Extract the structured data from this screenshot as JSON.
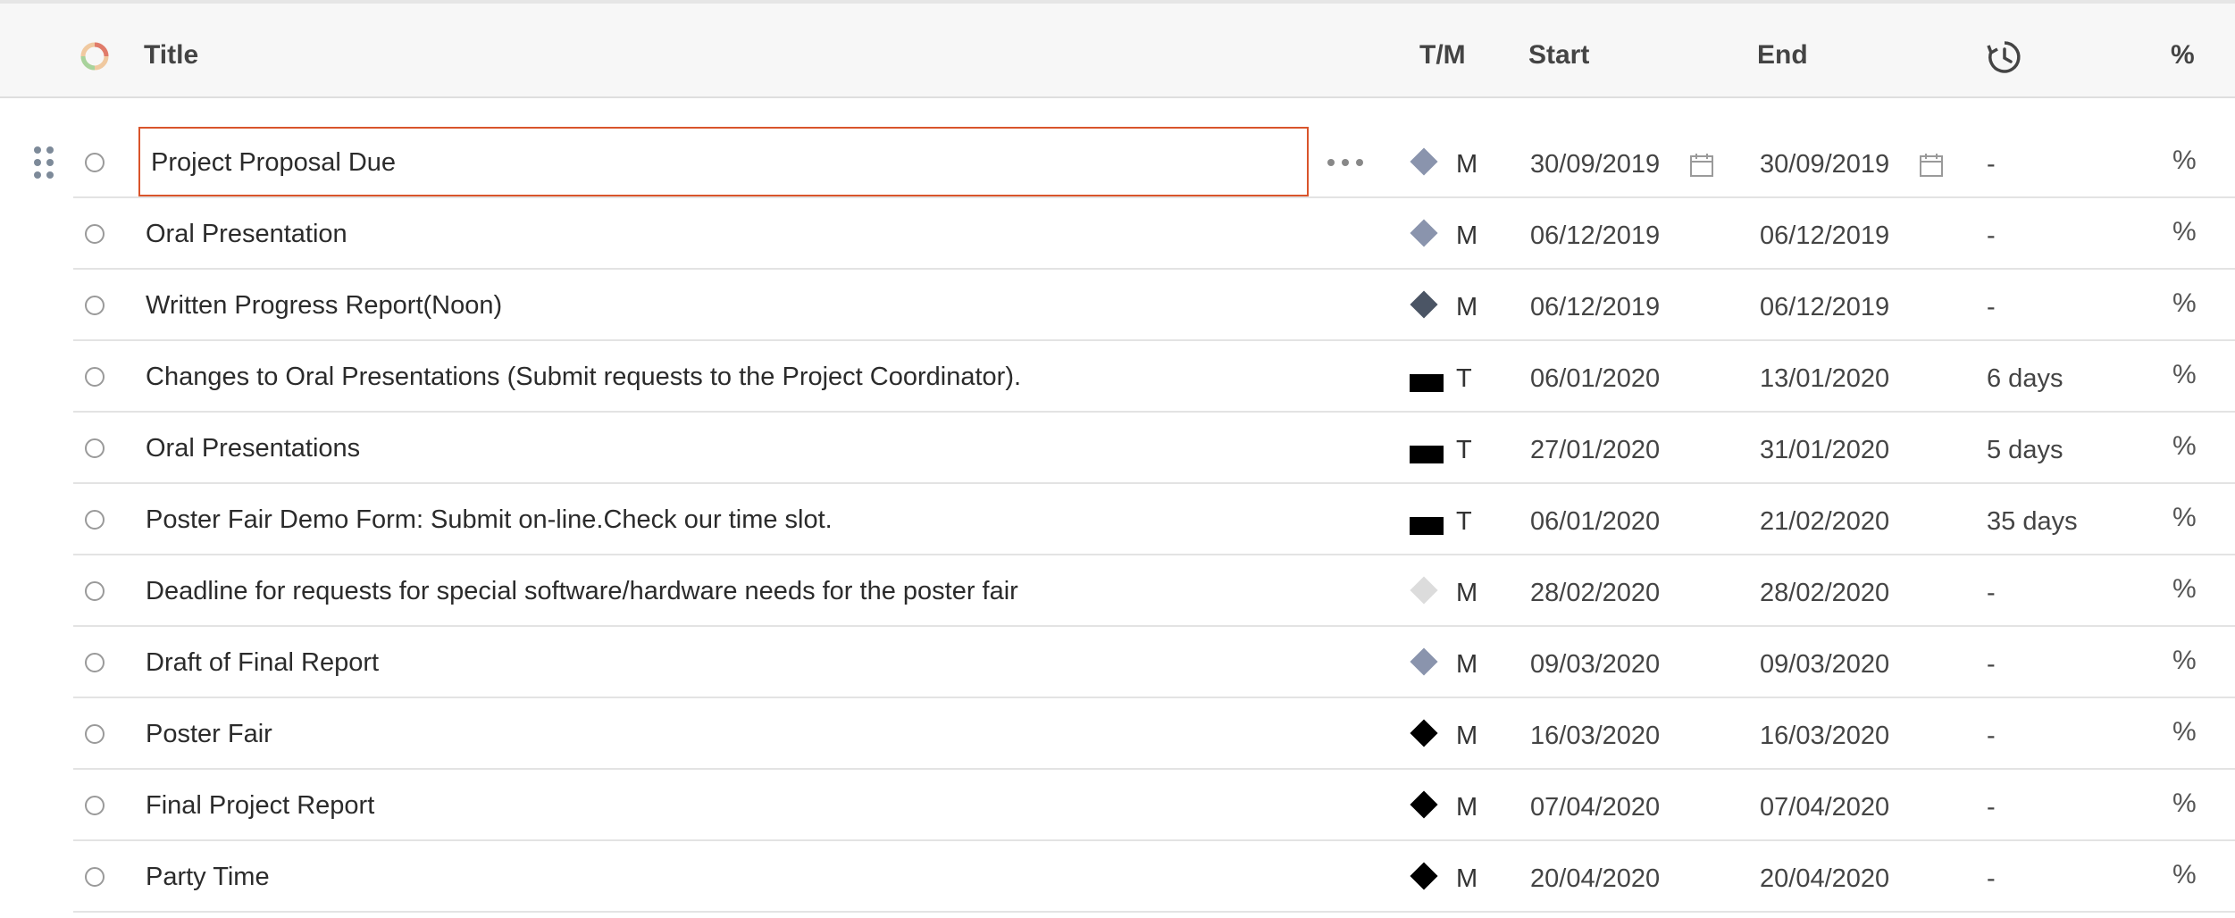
{
  "header": {
    "title": "Title",
    "type_column": "T/M",
    "start": "Start",
    "end": "End",
    "percent": "%",
    "history_icon": "history-clock-icon",
    "progress_icon": "progress-ring-icon"
  },
  "colors": {
    "accent_border": "#d9542b",
    "milestone_blue": "#8a94ad",
    "milestone_dark": "#4b5565",
    "milestone_light": "#dcdcdc",
    "milestone_black": "#000000",
    "task_bar": "#000000"
  },
  "more_icon": "more-dots-icon",
  "drag_icon": "drag-handle-icon",
  "calendar_icon": "calendar-icon",
  "rows": [
    {
      "title": "Project Proposal Due",
      "type": "M",
      "start": "30/09/2019",
      "end": "30/09/2019",
      "duration": "-",
      "percent": "%",
      "marker": "milestone_blue"
    },
    {
      "title": "Oral Presentation",
      "type": "M",
      "start": "06/12/2019",
      "end": "06/12/2019",
      "duration": "-",
      "percent": "%",
      "marker": "milestone_blue"
    },
    {
      "title": "Written Progress Report(Noon)",
      "type": "M",
      "start": "06/12/2019",
      "end": "06/12/2019",
      "duration": "-",
      "percent": "%",
      "marker": "milestone_dark"
    },
    {
      "title": "Changes to Oral Presentations (Submit requests to the Project Coordinator).",
      "type": "T",
      "start": "06/01/2020",
      "end": "13/01/2020",
      "duration": "6 days",
      "percent": "%",
      "marker": "task_bar"
    },
    {
      "title": "Oral Presentations",
      "type": "T",
      "start": "27/01/2020",
      "end": "31/01/2020",
      "duration": "5 days",
      "percent": "%",
      "marker": "task_bar"
    },
    {
      "title": "Poster Fair Demo Form: Submit on-line.Check our time slot.",
      "type": "T",
      "start": "06/01/2020",
      "end": "21/02/2020",
      "duration": "35 days",
      "percent": "%",
      "marker": "task_bar"
    },
    {
      "title": "Deadline for requests for special software/hardware needs for the poster fair",
      "type": "M",
      "start": "28/02/2020",
      "end": "28/02/2020",
      "duration": "-",
      "percent": "%",
      "marker": "milestone_light"
    },
    {
      "title": "Draft of Final Report",
      "type": "M",
      "start": "09/03/2020",
      "end": "09/03/2020",
      "duration": "-",
      "percent": "%",
      "marker": "milestone_blue"
    },
    {
      "title": "Poster Fair",
      "type": "M",
      "start": "16/03/2020",
      "end": "16/03/2020",
      "duration": "-",
      "percent": "%",
      "marker": "milestone_black"
    },
    {
      "title": "Final Project Report",
      "type": "M",
      "start": "07/04/2020",
      "end": "07/04/2020",
      "duration": "-",
      "percent": "%",
      "marker": "milestone_black"
    },
    {
      "title": "Party Time",
      "type": "M",
      "start": "20/04/2020",
      "end": "20/04/2020",
      "duration": "-",
      "percent": "%",
      "marker": "milestone_black"
    }
  ]
}
